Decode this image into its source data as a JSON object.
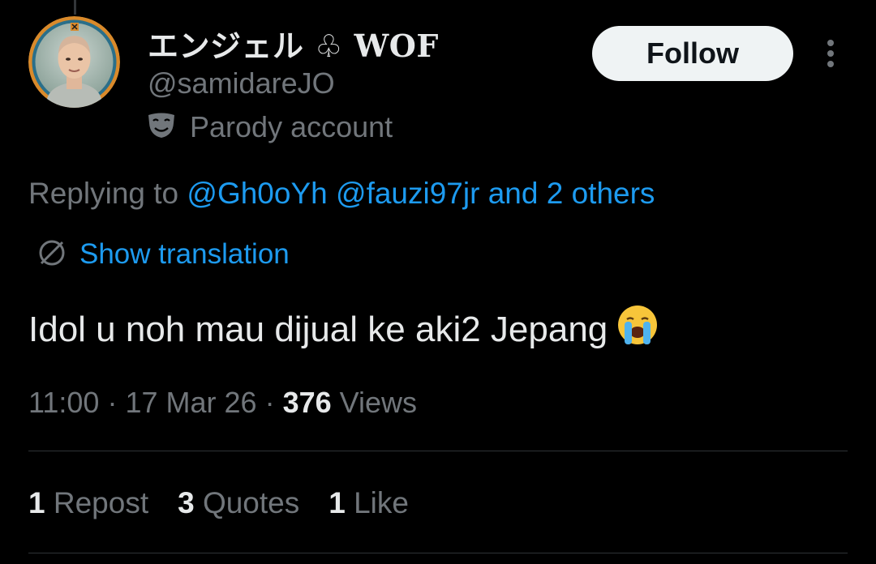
{
  "author": {
    "display_name": "エンジェル",
    "name_symbol": "♧",
    "name_suffix": "WOF",
    "handle": "@samidareJO",
    "account_label": "Parody account",
    "account_label_icon": "theater-mask-icon",
    "avatar_icon": "user-avatar"
  },
  "follow_button": {
    "label": "Follow"
  },
  "more_menu": {
    "icon": "more-vertical-icon"
  },
  "reply_context": {
    "prefix": "Replying to",
    "mentions": [
      "@Gh0oYh",
      "@fauzi97jr"
    ],
    "others": "and 2 others"
  },
  "translation": {
    "icon": "translate-globe-icon",
    "label": "Show translation"
  },
  "tweet": {
    "text": "Idol u noh mau dijual ke aki2 Jepang",
    "emoji": "😭"
  },
  "meta": {
    "time": "11:00",
    "separator": "·",
    "date": "17 Mar 26",
    "views_count": "376",
    "views_label": "Views"
  },
  "stats": [
    {
      "count": "1",
      "label": "Repost"
    },
    {
      "count": "3",
      "label": "Quotes"
    },
    {
      "count": "1",
      "label": "Like"
    }
  ],
  "colors": {
    "background": "#000000",
    "primary_text": "#e7e9ea",
    "secondary_text": "#71767b",
    "link": "#1d9bf0",
    "divider": "#2f3336",
    "follow_bg": "#eff3f4",
    "follow_text": "#0f1419"
  }
}
